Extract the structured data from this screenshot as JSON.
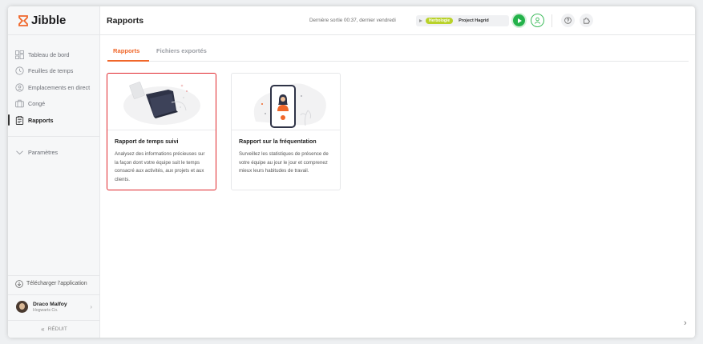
{
  "app": {
    "name": "Jibble"
  },
  "sidebar": {
    "items": [
      {
        "label": "Tableau de bord",
        "icon": "dashboard-icon"
      },
      {
        "label": "Feuilles de temps",
        "icon": "clock-icon"
      },
      {
        "label": "Emplacements en direct",
        "icon": "location-pin-icon"
      },
      {
        "label": "Congé",
        "icon": "suitcase-icon"
      },
      {
        "label": "Rapports",
        "icon": "clipboard-icon",
        "active": true
      }
    ],
    "settings_label": "Paramètres",
    "download_label": "Télécharger l'application",
    "user": {
      "name": "Draco Malfoy",
      "org": "Hogwarts Co."
    },
    "collapse_label": "RÉDUIT"
  },
  "header": {
    "title": "Rapports",
    "last_out": "Dernière sortie 00:37, dernier vendredi",
    "tracker": {
      "activity": "Herbologie",
      "project": "Project Hagrid"
    }
  },
  "tabs": [
    {
      "label": "Rapports",
      "active": true
    },
    {
      "label": "Fichiers exportés",
      "active": false
    }
  ],
  "cards": [
    {
      "title": "Rapport de temps suivi",
      "description": "Analysez des informations précieuses sur la façon dont votre équipe suit le temps consacré aux activités, aux projets et aux clients."
    },
    {
      "title": "Rapport sur la fréquentation",
      "description": "Surveillez les statistiques de présence de votre équipe au jour le jour et comprenez mieux leurs habitudes de travail."
    }
  ],
  "colors": {
    "accent": "#f0672a",
    "play": "#23b24a",
    "tag": "#b9d22a",
    "selection": "#e0262b"
  }
}
